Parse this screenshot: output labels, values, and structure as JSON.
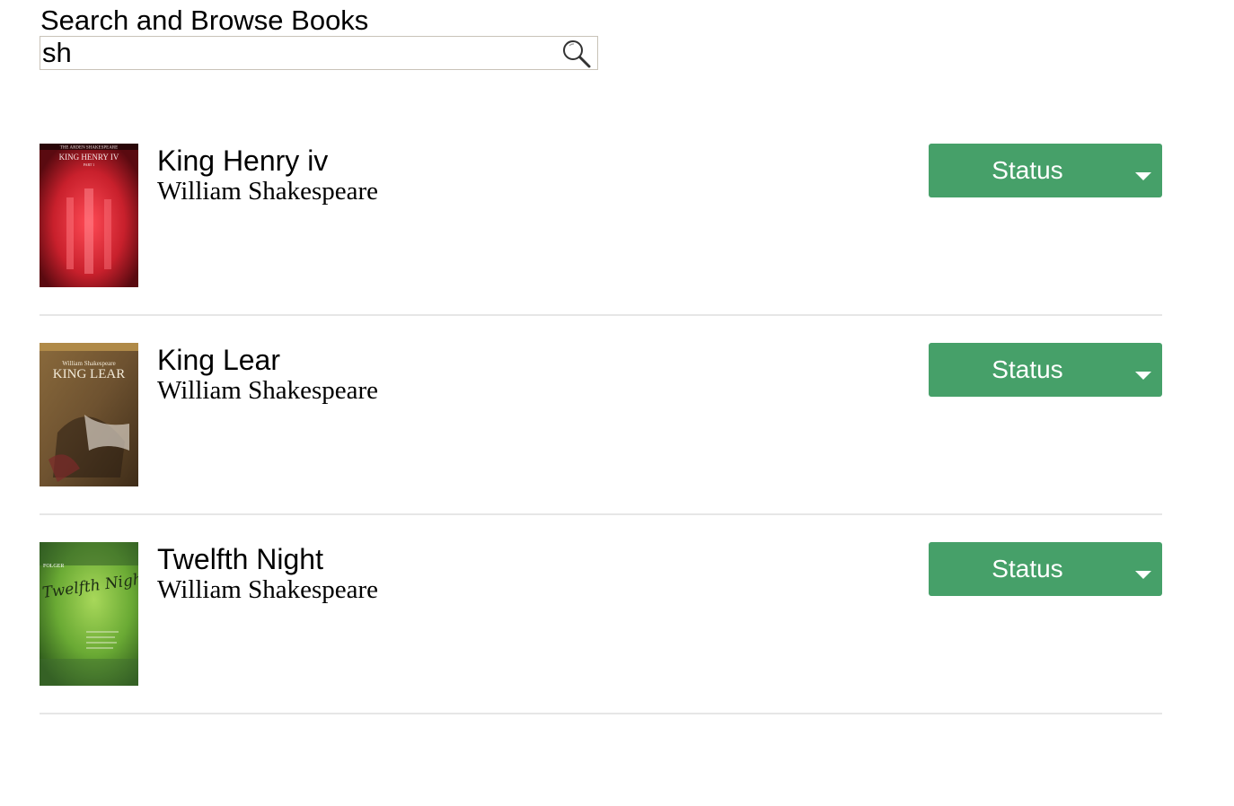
{
  "header": {
    "title": "Search and Browse Books"
  },
  "search": {
    "value": "sh",
    "icon": "search-icon"
  },
  "books": [
    {
      "title": "King Henry iv",
      "author": "William Shakespeare",
      "status_label": "Status",
      "cover_text": [
        "THE ARDEN SHAKESPEARE",
        "KING HENRY IV",
        "PART 1"
      ]
    },
    {
      "title": "King Lear",
      "author": "William Shakespeare",
      "status_label": "Status",
      "cover_text": [
        "William Shakespeare",
        "KING LEAR"
      ]
    },
    {
      "title": "Twelfth Night",
      "author": "William Shakespeare",
      "status_label": "Status",
      "cover_text": [
        "FOLGER",
        "Twelfth Night"
      ]
    }
  ],
  "colors": {
    "status_button": "#46a069",
    "divider": "#e6e6e6",
    "search_border": "#c9c3b8"
  }
}
